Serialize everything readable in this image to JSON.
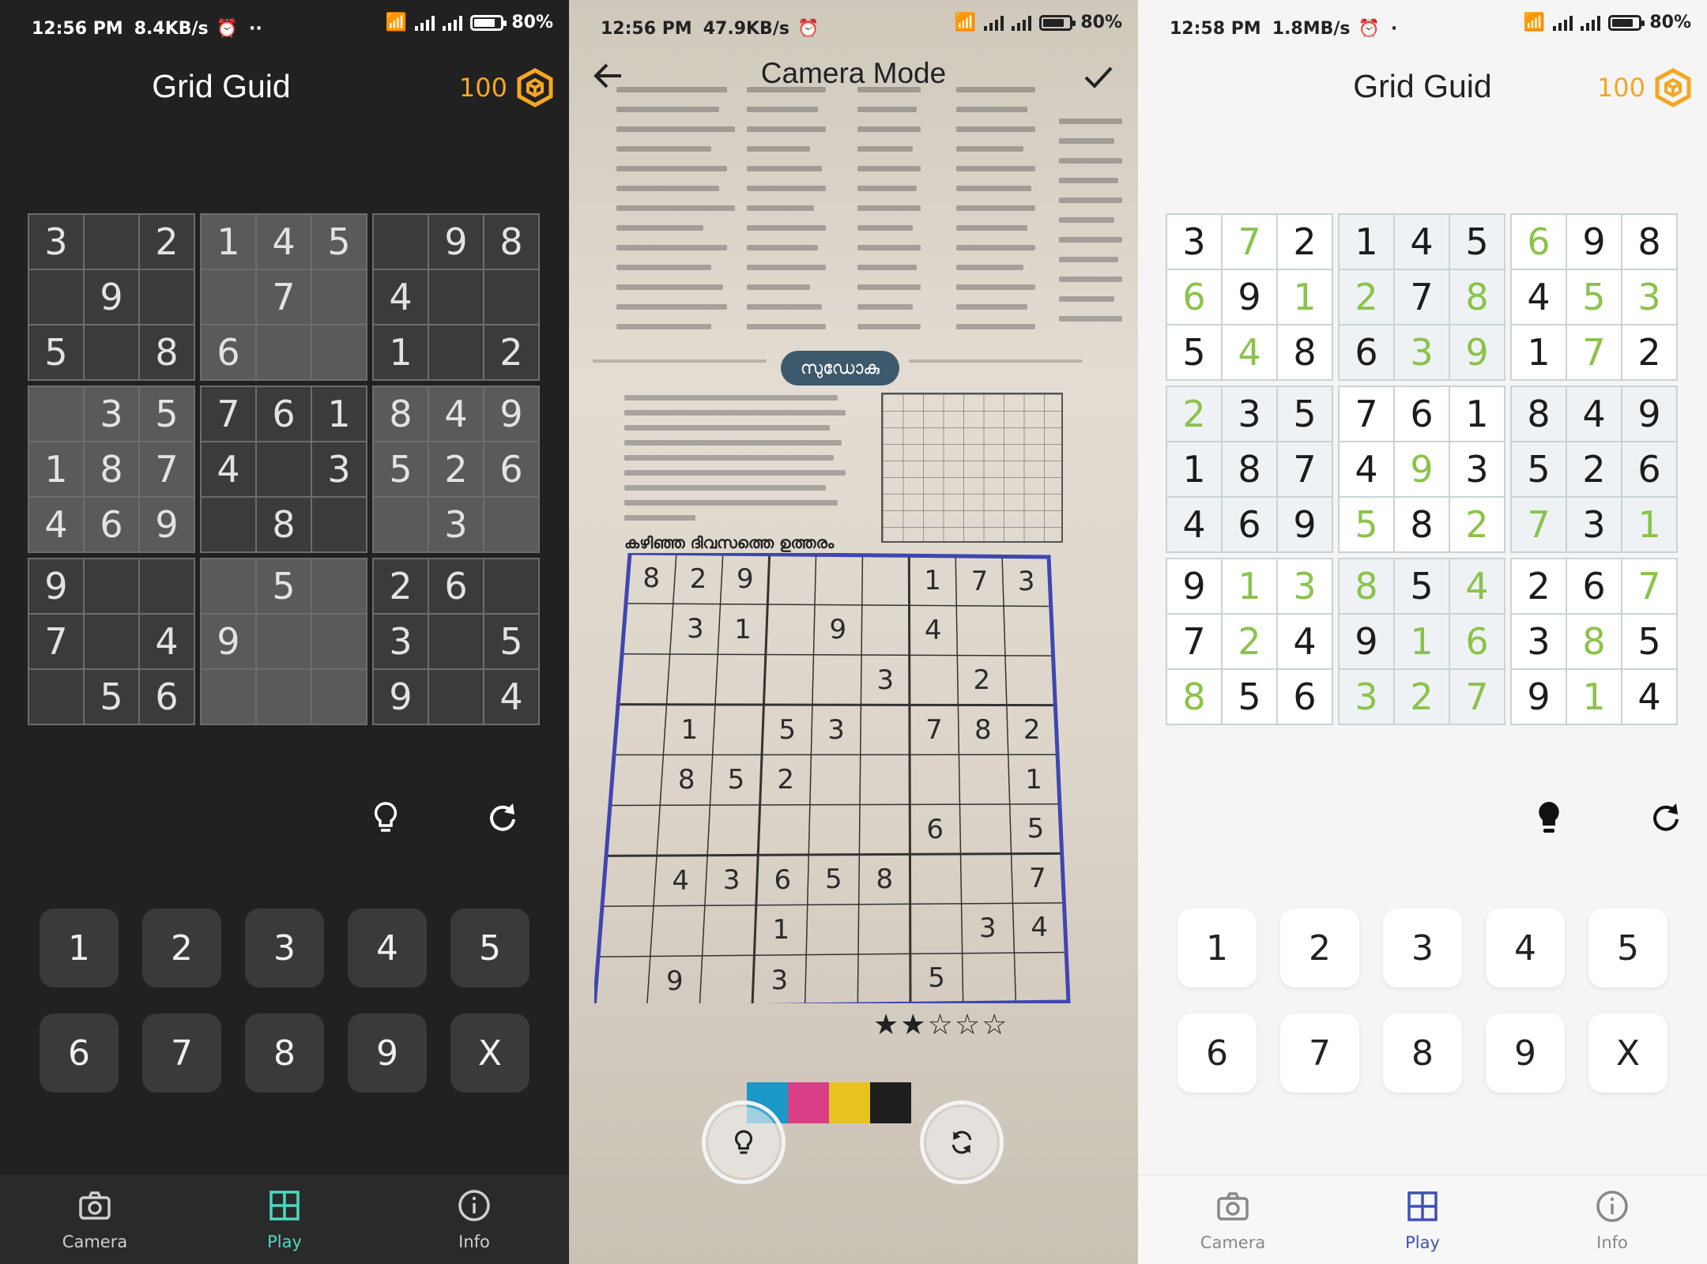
{
  "colors": {
    "dark_bg": "#212121",
    "light_bg": "#f5f5f5",
    "accent_coin": "#f5a623",
    "nav_active_dark": "#4dd8bf",
    "nav_active_light": "#3f51b5",
    "user_digit_green": "#8bc34a",
    "detect_border": "#3f46b0"
  },
  "panel_dark": {
    "status": {
      "time": "12:56 PM",
      "speed": "8.4KB/s",
      "battery": "80%"
    },
    "title": "Grid Guid",
    "coins": "100",
    "coin_icon": "hexagon-coin-icon",
    "tools": {
      "hint_icon": "bulb-outline-icon",
      "reset_icon": "refresh-icon"
    },
    "keypad": [
      "1",
      "2",
      "3",
      "4",
      "5",
      "6",
      "7",
      "8",
      "9",
      "X"
    ],
    "nav": [
      {
        "label": "Camera",
        "icon": "camera-icon"
      },
      {
        "label": "Play",
        "icon": "grid-icon",
        "active": true
      },
      {
        "label": "Info",
        "icon": "info-icon"
      }
    ],
    "grid": [
      [
        "3",
        "",
        "2",
        "1",
        "4",
        "5",
        "",
        "9",
        "8"
      ],
      [
        "",
        "9",
        "",
        "",
        "7",
        "",
        "4",
        "",
        ""
      ],
      [
        "5",
        "",
        "8",
        "6",
        "",
        "",
        "1",
        "",
        "2"
      ],
      [
        "",
        "3",
        "5",
        "7",
        "6",
        "1",
        "8",
        "4",
        "9"
      ],
      [
        "1",
        "8",
        "7",
        "4",
        "",
        "3",
        "5",
        "2",
        "6"
      ],
      [
        "4",
        "6",
        "9",
        "",
        "8",
        "",
        "",
        "3",
        ""
      ],
      [
        "9",
        "",
        "",
        "",
        "5",
        "",
        "2",
        "6",
        ""
      ],
      [
        "7",
        "",
        "4",
        "9",
        "",
        "",
        "3",
        "",
        "5"
      ],
      [
        "",
        "5",
        "6",
        "",
        "",
        "",
        "9",
        "",
        "4"
      ]
    ]
  },
  "panel_camera": {
    "status": {
      "time": "12:56 PM",
      "speed": "47.9KB/s",
      "battery": "80%"
    },
    "title": "Camera Mode",
    "badge_text": "സുഡോകു",
    "caption": "കഴിഞ്ഞ ദിവസത്തെ ഉത്തരം",
    "stars": "★★☆☆☆",
    "swatch_colors": [
      "#1a98c7",
      "#d93f86",
      "#e6c31f",
      "#1e1e1e"
    ],
    "buttons": {
      "hint_icon": "bulb-outline-icon",
      "rotate_icon": "rotate-icon"
    },
    "scanned": [
      [
        "8",
        "2",
        "9",
        "",
        "",
        "",
        "1",
        "7",
        "3"
      ],
      [
        "",
        "3",
        "1",
        "",
        "9",
        "",
        "4",
        "",
        ""
      ],
      [
        "",
        "",
        "",
        "",
        "",
        "3",
        "",
        "2",
        ""
      ],
      [
        "",
        "1",
        "",
        "5",
        "3",
        "",
        "7",
        "8",
        "2"
      ],
      [
        "",
        "8",
        "5",
        "2",
        "",
        "",
        "",
        "",
        "1"
      ],
      [
        "",
        "",
        "",
        "",
        "",
        "",
        "6",
        "",
        "5"
      ],
      [
        "",
        "4",
        "3",
        "6",
        "5",
        "8",
        "",
        "",
        "7"
      ],
      [
        "",
        "",
        "",
        "1",
        "",
        "",
        "",
        "3",
        "4"
      ],
      [
        "",
        "9",
        "",
        "3",
        "",
        "",
        "5",
        "",
        ""
      ]
    ]
  },
  "panel_light": {
    "status": {
      "time": "12:58 PM",
      "speed": "1.8MB/s",
      "battery": "80%"
    },
    "title": "Grid Guid",
    "coins": "100",
    "coin_icon": "hexagon-coin-icon",
    "tools": {
      "hint_icon": "bulb-filled-icon",
      "reset_icon": "refresh-icon"
    },
    "keypad": [
      "1",
      "2",
      "3",
      "4",
      "5",
      "6",
      "7",
      "8",
      "9",
      "X"
    ],
    "nav": [
      {
        "label": "Camera",
        "icon": "camera-icon"
      },
      {
        "label": "Play",
        "icon": "grid-icon",
        "active": true
      },
      {
        "label": "Info",
        "icon": "info-icon"
      }
    ],
    "grid": [
      [
        "3",
        "7",
        "2",
        "1",
        "4",
        "5",
        "6",
        "9",
        "8"
      ],
      [
        "6",
        "9",
        "1",
        "2",
        "7",
        "8",
        "4",
        "5",
        "3"
      ],
      [
        "5",
        "4",
        "8",
        "6",
        "3",
        "9",
        "1",
        "7",
        "2"
      ],
      [
        "2",
        "3",
        "5",
        "7",
        "6",
        "1",
        "8",
        "4",
        "9"
      ],
      [
        "1",
        "8",
        "7",
        "4",
        "9",
        "3",
        "5",
        "2",
        "6"
      ],
      [
        "4",
        "6",
        "9",
        "5",
        "8",
        "2",
        "7",
        "3",
        "1"
      ],
      [
        "9",
        "1",
        "3",
        "8",
        "5",
        "4",
        "2",
        "6",
        "7"
      ],
      [
        "7",
        "2",
        "4",
        "9",
        "1",
        "6",
        "3",
        "8",
        "5"
      ],
      [
        "8",
        "5",
        "6",
        "3",
        "2",
        "7",
        "9",
        "1",
        "4"
      ]
    ],
    "user_entered": [
      [
        0,
        1,
        0,
        0,
        0,
        0,
        1,
        0,
        0
      ],
      [
        1,
        0,
        1,
        1,
        0,
        1,
        0,
        1,
        1
      ],
      [
        0,
        1,
        0,
        0,
        1,
        1,
        0,
        1,
        0
      ],
      [
        1,
        0,
        0,
        0,
        0,
        0,
        0,
        0,
        0
      ],
      [
        0,
        0,
        0,
        0,
        1,
        0,
        0,
        0,
        0
      ],
      [
        0,
        0,
        0,
        1,
        0,
        1,
        1,
        0,
        1
      ],
      [
        0,
        1,
        1,
        1,
        0,
        1,
        0,
        0,
        1
      ],
      [
        0,
        1,
        0,
        0,
        1,
        1,
        0,
        1,
        0
      ],
      [
        1,
        0,
        0,
        1,
        1,
        1,
        0,
        1,
        0
      ]
    ]
  }
}
